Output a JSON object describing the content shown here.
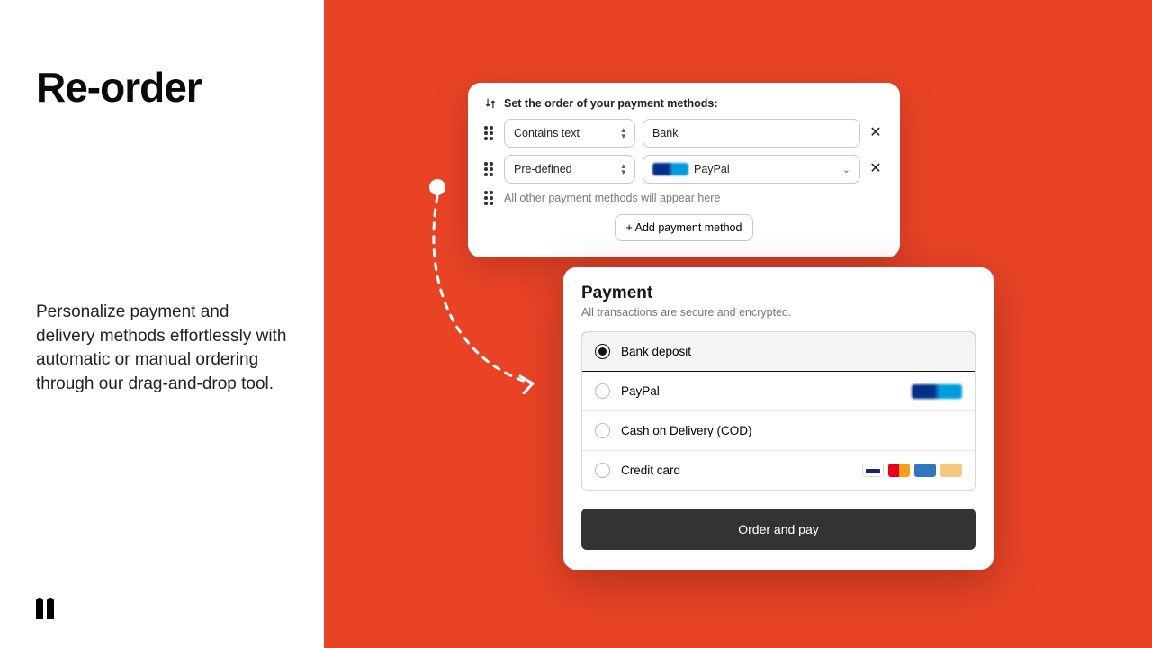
{
  "left": {
    "title": "Re-order",
    "description": "Personalize payment and delivery methods effortlessly with automatic or manual ordering through our drag-and-drop tool."
  },
  "config": {
    "header": "Set the order of your payment methods:",
    "rows": [
      {
        "mode": "Contains text",
        "value": "Bank"
      },
      {
        "mode": "Pre-defined",
        "value": "PayPal"
      }
    ],
    "placeholder": "All other payment methods will appear here",
    "addLabel": "+ Add payment method"
  },
  "payment": {
    "title": "Payment",
    "subtitle": "All transactions are secure and encrypted.",
    "options": [
      {
        "label": "Bank deposit",
        "selected": true
      },
      {
        "label": "PayPal",
        "selected": false
      },
      {
        "label": "Cash on Delivery (COD)",
        "selected": false
      },
      {
        "label": "Credit card",
        "selected": false
      }
    ],
    "cta": "Order and pay"
  }
}
